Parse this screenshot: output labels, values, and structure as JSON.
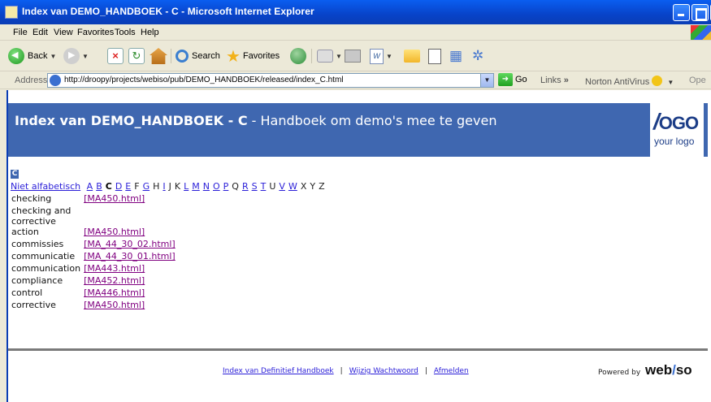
{
  "window": {
    "title": "Index van DEMO_HANDBOEK - C - Microsoft Internet Explorer"
  },
  "menu": [
    "File",
    "Edit",
    "View",
    "Favorites",
    "Tools",
    "Help"
  ],
  "toolbar": {
    "back_label": "Back",
    "search_label": "Search",
    "favorites_label": "Favorites"
  },
  "address": {
    "label": "Address",
    "url": "http://droopy/projects/webiso/pub/DEMO_HANDBOEK/released/index_C.html",
    "go_label": "Go",
    "links_label": "Links",
    "links_chevron": "»",
    "norton_label": "Norton AntiVirus",
    "ope_label": "Ope"
  },
  "banner": {
    "title_bold": "Index van DEMO_HANDBOEK - C",
    "title_rest": " - Handboek om demo's mee te geven",
    "logo_text": "OGO",
    "logo_slash": "/",
    "logo_sub": "your logo"
  },
  "section_letter": "C",
  "alphabet": {
    "first": "Niet alfabetisch",
    "letters": [
      {
        "l": "A",
        "linked": true
      },
      {
        "l": "B",
        "linked": true
      },
      {
        "l": "C",
        "linked": false,
        "current": true
      },
      {
        "l": "D",
        "linked": true
      },
      {
        "l": "E",
        "linked": true
      },
      {
        "l": "F",
        "linked": false
      },
      {
        "l": "G",
        "linked": true
      },
      {
        "l": "H",
        "linked": false
      },
      {
        "l": "I",
        "linked": true
      },
      {
        "l": "J",
        "linked": false
      },
      {
        "l": "K",
        "linked": false
      },
      {
        "l": "L",
        "linked": true
      },
      {
        "l": "M",
        "linked": true
      },
      {
        "l": "N",
        "linked": true
      },
      {
        "l": "O",
        "linked": true
      },
      {
        "l": "P",
        "linked": true
      },
      {
        "l": "Q",
        "linked": false
      },
      {
        "l": "R",
        "linked": true
      },
      {
        "l": "S",
        "linked": true
      },
      {
        "l": "T",
        "linked": true
      },
      {
        "l": "U",
        "linked": false
      },
      {
        "l": "V",
        "linked": true
      },
      {
        "l": "W",
        "linked": true
      },
      {
        "l": "X",
        "linked": false
      },
      {
        "l": "Y",
        "linked": false
      },
      {
        "l": "Z",
        "linked": false
      }
    ]
  },
  "entries": [
    {
      "term": "checking",
      "link": "[MA450.html]"
    },
    {
      "term": "checking and corrective action",
      "link": "[MA450.html]"
    },
    {
      "term": "commissies",
      "link": "[MA_44_30_02.html]"
    },
    {
      "term": "communicatie",
      "link": "[MA_44_30_01.html]"
    },
    {
      "term": "communication",
      "link": "[MA443.html]"
    },
    {
      "term": "compliance",
      "link": "[MA452.html]"
    },
    {
      "term": "control",
      "link": "[MA446.html]"
    },
    {
      "term": "corrective",
      "link": "[MA450.html]"
    }
  ],
  "footer": {
    "powered_by": "Powered by",
    "brand_a": "web",
    "brand_b": "/",
    "brand_c": "so",
    "links": [
      "Index van Definitief Handboek",
      "Wijzig Wachtwoord",
      "Afmelden"
    ],
    "separator": "|"
  },
  "colors": {
    "banner": "#3f67b0",
    "titlebar": "#0a5ef0",
    "link": "#2a1ed8",
    "visited_link": "#800080"
  }
}
